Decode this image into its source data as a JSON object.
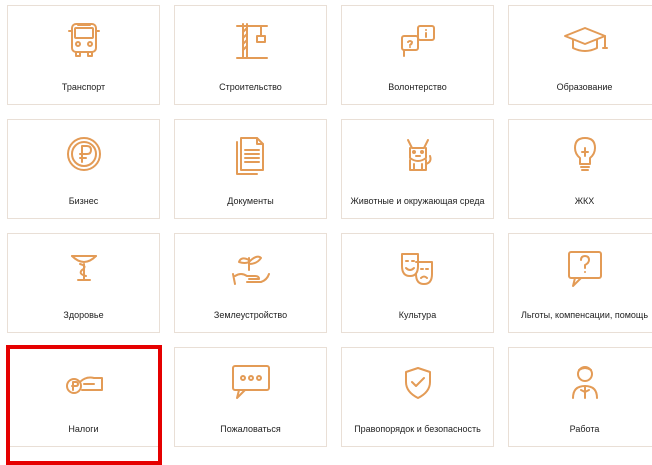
{
  "colors": {
    "icon": "#e39b56",
    "tile_border": "#e9dfd6",
    "label_text": "#222222",
    "highlight": "#e50000"
  },
  "tiles": [
    {
      "id": "transport",
      "label": "Транспорт",
      "icon": "bus-icon"
    },
    {
      "id": "construction",
      "label": "Строительство",
      "icon": "crane-icon"
    },
    {
      "id": "volunteer",
      "label": "Волонтерство",
      "icon": "info-bubbles-icon"
    },
    {
      "id": "education",
      "label": "Образование",
      "icon": "graduation-cap-icon"
    },
    {
      "id": "business",
      "label": "Бизнес",
      "icon": "ruble-coin-icon"
    },
    {
      "id": "documents",
      "label": "Документы",
      "icon": "documents-icon"
    },
    {
      "id": "animals",
      "label": "Животные и окружающая среда",
      "icon": "dog-icon"
    },
    {
      "id": "housing",
      "label": "ЖКХ",
      "icon": "light-bulb-icon"
    },
    {
      "id": "health",
      "label": "Здоровье",
      "icon": "medical-bowl-icon"
    },
    {
      "id": "land",
      "label": "Землеустройство",
      "icon": "plant-hand-icon"
    },
    {
      "id": "culture",
      "label": "Культура",
      "icon": "theatre-masks-icon"
    },
    {
      "id": "benefits",
      "label": "Льготы, компенсации, помощь",
      "icon": "question-bubble-icon"
    },
    {
      "id": "taxes",
      "label": "Налоги",
      "icon": "hand-coin-icon"
    },
    {
      "id": "complain",
      "label": "Пожаловаться",
      "icon": "chat-dots-icon"
    },
    {
      "id": "law",
      "label": "Правопорядок и безопасность",
      "icon": "shield-check-icon"
    },
    {
      "id": "work",
      "label": "Работа",
      "icon": "worker-icon"
    }
  ]
}
